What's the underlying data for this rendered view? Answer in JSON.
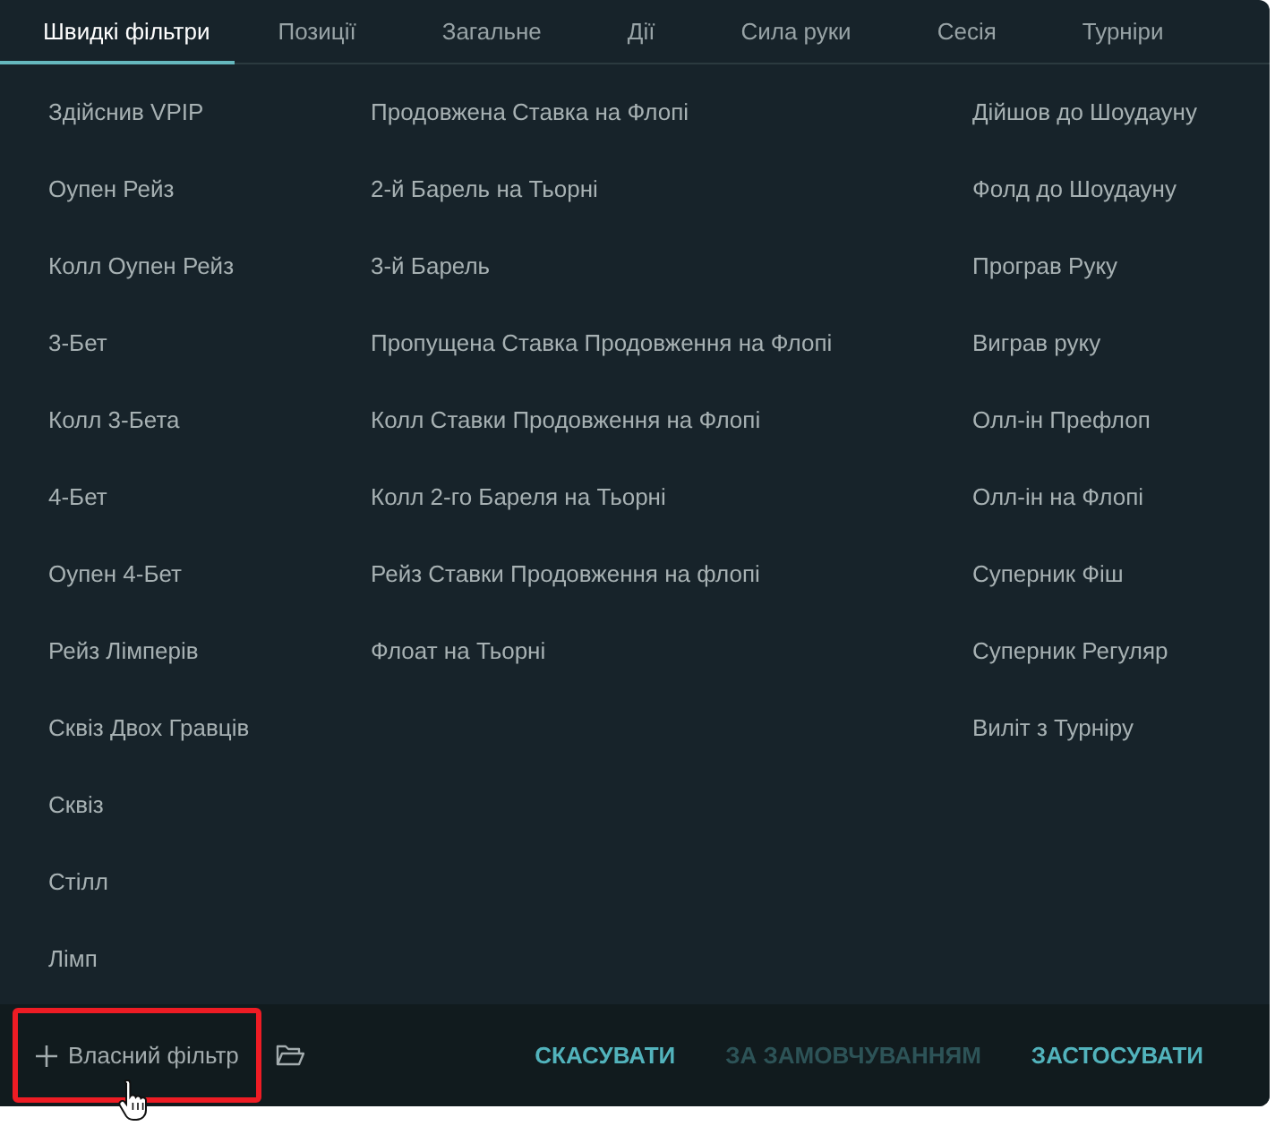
{
  "tabs": [
    {
      "label": "Швидкі фільтри",
      "selected": true
    },
    {
      "label": "Позиції",
      "selected": false
    },
    {
      "label": "Загальне",
      "selected": false
    },
    {
      "label": "Дії",
      "selected": false
    },
    {
      "label": "Сила руки",
      "selected": false
    },
    {
      "label": "Сесія",
      "selected": false
    },
    {
      "label": "Турніри",
      "selected": false
    }
  ],
  "filter_columns": [
    {
      "items": [
        "Здійснив VPIP",
        "Оупен Рейз",
        "Колл Оупен Рейз",
        "3-Бет",
        "Колл 3-Бета",
        "4-Бет",
        "Оупен 4-Бет",
        "Рейз Лімперів",
        "Сквіз Двох Гравців",
        "Сквіз",
        "Стілл",
        "Лімп"
      ]
    },
    {
      "items": [
        "Продовжена Ставка на Флопі",
        "2-й Барель на Тьорні",
        "3-й Барель",
        "Пропущена Ставка Продовження на Флопі",
        "Колл Ставки Продовження на Флопі",
        "Колл 2-го Бареля на Тьорні",
        "Рейз Ставки Продовження на флопі",
        "Флоат на Тьорні"
      ]
    },
    {
      "items": [
        "Дійшов до Шоудауну",
        "Фолд до Шоудауну",
        "Програв Руку",
        "Виграв руку",
        "Олл-ін Префлоп",
        "Олл-ін на Флопі",
        "Суперник Фіш",
        "Суперник Регуляр",
        "Виліт з Турніру"
      ]
    }
  ],
  "footer": {
    "custom_filter": {
      "label": "Власний фільтр",
      "highlighted": true,
      "hovered": true
    },
    "actions": [
      {
        "label": "СКАСУВАТИ",
        "disabled": false
      },
      {
        "label": "ЗА ЗАМОВЧУВАННЯМ",
        "disabled": true
      },
      {
        "label": "ЗАСТОСУВАТИ",
        "disabled": false
      }
    ]
  }
}
